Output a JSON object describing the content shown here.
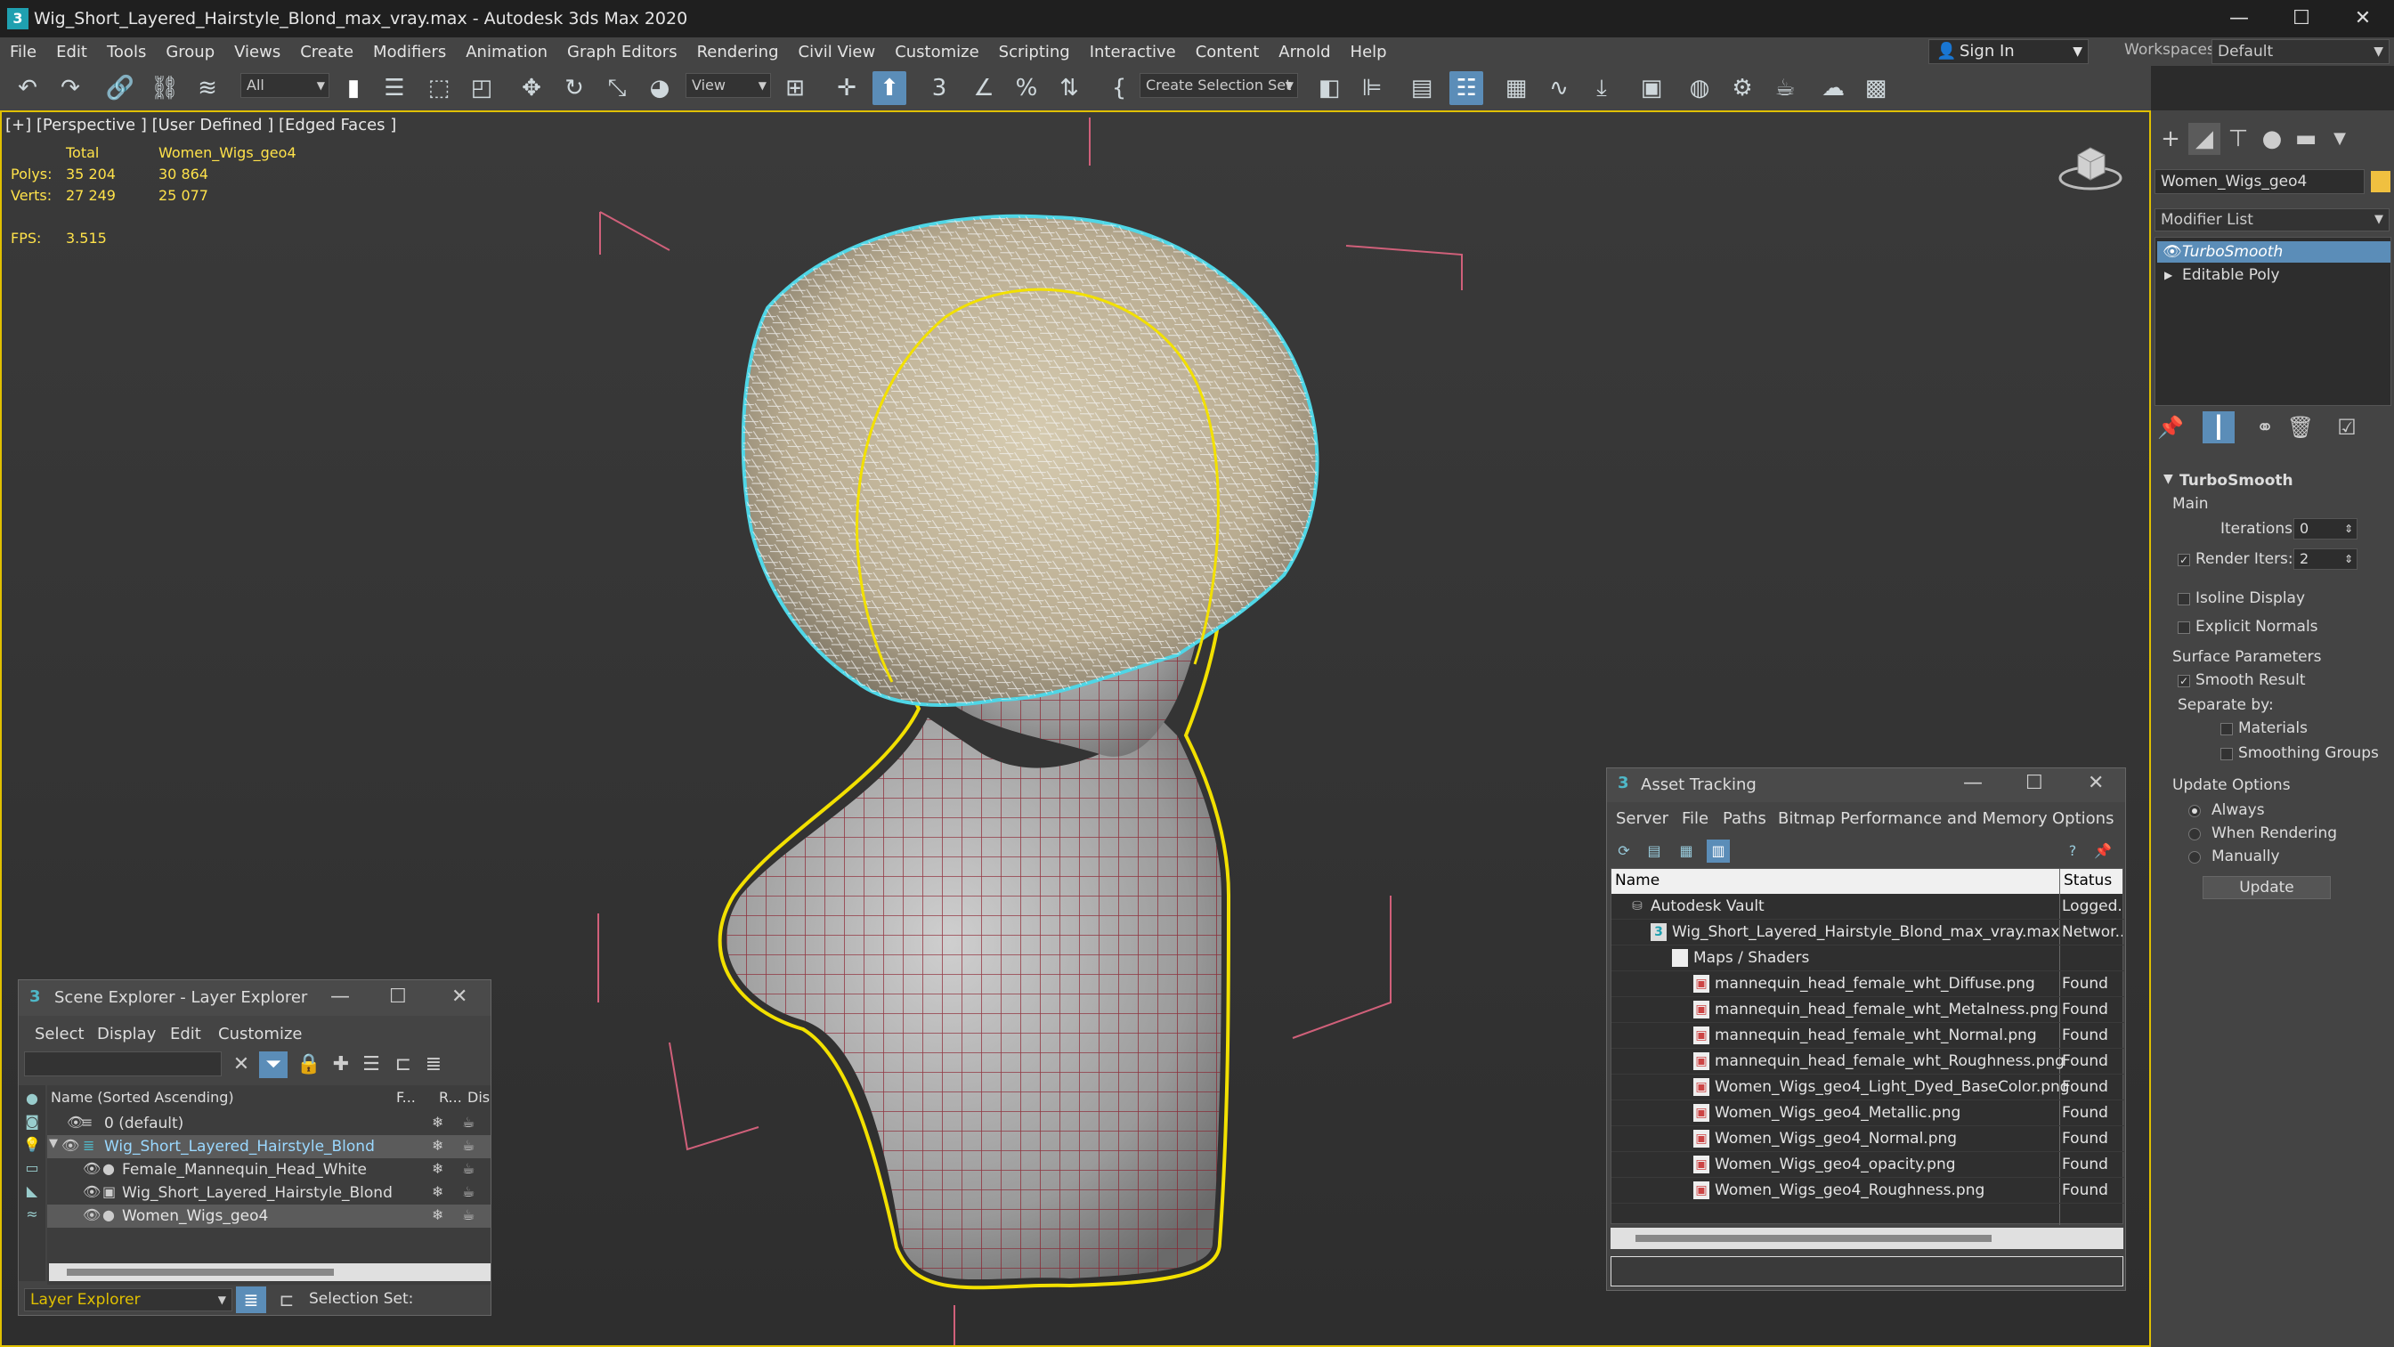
{
  "window": {
    "title": "Wig_Short_Layered_Hairstyle_Blond_max_vray.max - Autodesk 3ds Max 2020",
    "app_icon": "3",
    "minimize": "—",
    "maximize": "☐",
    "close": "✕"
  },
  "menu": [
    "File",
    "Edit",
    "Tools",
    "Group",
    "Views",
    "Create",
    "Modifiers",
    "Animation",
    "Graph Editors",
    "Rendering",
    "Civil View",
    "Customize",
    "Scripting",
    "Interactive",
    "Content",
    "Arnold",
    "Help"
  ],
  "account": {
    "sign_in": "Sign In",
    "workspaces_label": "Workspaces:",
    "workspace": "Default"
  },
  "toolbar": {
    "filter": "All",
    "ref_coord": "View",
    "selection_set": "Create Selection Set",
    "icons": [
      "undo-icon",
      "redo-icon",
      "link-icon",
      "unlink-icon",
      "bind-space-warp-icon",
      "select-object-icon",
      "select-by-name-icon",
      "rectangle-selection-icon",
      "window-crossing-icon",
      "move-icon",
      "rotate-icon",
      "scale-icon",
      "placement-icon",
      "pivot-icon",
      "snap-icon",
      "angle-snap-icon",
      "percent-snap-icon",
      "spinner-snap-icon",
      "mirror-icon",
      "align-icon",
      "scene-explorer-icon",
      "layer-explorer-icon",
      "ribbon-icon",
      "curve-editor-icon",
      "schematic-view-icon",
      "material-editor-icon",
      "render-setup-icon",
      "rendered-frame-icon",
      "render-icon",
      "render-online-icon"
    ]
  },
  "viewport": {
    "label": "[+] [Perspective ] [User Defined ] [Edged Faces ]",
    "stats": {
      "col_total": "Total",
      "col_object": "Women_Wigs_geo4",
      "polys_label": "Polys:",
      "polys_total": "35 204",
      "polys_object": "30 864",
      "verts_label": "Verts:",
      "verts_total": "27 249",
      "verts_object": "25 077",
      "fps_label": "FPS:",
      "fps_value": "3.515"
    }
  },
  "command_panel": {
    "object_name": "Women_Wigs_geo4",
    "modifier_list": "Modifier List",
    "stack": [
      "TurboSmooth",
      "Editable Poly"
    ],
    "rollout_title": "TurboSmooth",
    "main_label": "Main",
    "iterations_label": "Iterations:",
    "iterations_value": "0",
    "render_iters_label": "Render Iters:",
    "render_iters_value": "2",
    "isoline_display": "Isoline Display",
    "explicit_normals": "Explicit Normals",
    "surface_params": "Surface Parameters",
    "smooth_result": "Smooth Result",
    "separate_by": "Separate by:",
    "materials": "Materials",
    "smoothing_groups": "Smoothing Groups",
    "update_options": "Update Options",
    "always": "Always",
    "when_rendering": "When Rendering",
    "manually": "Manually",
    "update_button": "Update"
  },
  "scene_explorer": {
    "title": "Scene Explorer - Layer Explorer",
    "menu": [
      "Select",
      "Display",
      "Edit",
      "Customize"
    ],
    "col_name": "Name (Sorted Ascending)",
    "col_f": "F...",
    "col_r": "R...",
    "col_dis": "Dis",
    "rows": [
      {
        "name": "0 (default)"
      },
      {
        "name": "Wig_Short_Layered_Hairstyle_Blond"
      },
      {
        "name": "Female_Mannequin_Head_White"
      },
      {
        "name": "Wig_Short_Layered_Hairstyle_Blond"
      },
      {
        "name": "Women_Wigs_geo4"
      }
    ],
    "layer_explorer": "Layer Explorer",
    "selection_set": "Selection Set:"
  },
  "asset_tracking": {
    "title": "Asset Tracking",
    "menu": [
      "Server",
      "File",
      "Paths",
      "Bitmap Performance and Memory",
      "Options"
    ],
    "col_name": "Name",
    "col_status": "Status",
    "rows": [
      {
        "name": "Autodesk Vault",
        "status": "Logged..."
      },
      {
        "name": "Wig_Short_Layered_Hairstyle_Blond_max_vray.max",
        "status": "Networ..."
      },
      {
        "name": "Maps / Shaders",
        "status": ""
      },
      {
        "name": "mannequin_head_female_wht_Diffuse.png",
        "status": "Found"
      },
      {
        "name": "mannequin_head_female_wht_Metalness.png",
        "status": "Found"
      },
      {
        "name": "mannequin_head_female_wht_Normal.png",
        "status": "Found"
      },
      {
        "name": "mannequin_head_female_wht_Roughness.png",
        "status": "Found"
      },
      {
        "name": "Women_Wigs_geo4_Light_Dyed_BaseColor.png",
        "status": "Found"
      },
      {
        "name": "Women_Wigs_geo4_Metallic.png",
        "status": "Found"
      },
      {
        "name": "Women_Wigs_geo4_Normal.png",
        "status": "Found"
      },
      {
        "name": "Women_Wigs_geo4_opacity.png",
        "status": "Found"
      },
      {
        "name": "Women_Wigs_geo4_Roughness.png",
        "status": "Found"
      }
    ]
  },
  "colors": {
    "accent": "#5b8db8",
    "selection_yellow": "#e0c000",
    "stats_yellow": "#ffe24a",
    "wire_red": "#8a1a28",
    "hair_cyan": "#4fd6e6"
  }
}
